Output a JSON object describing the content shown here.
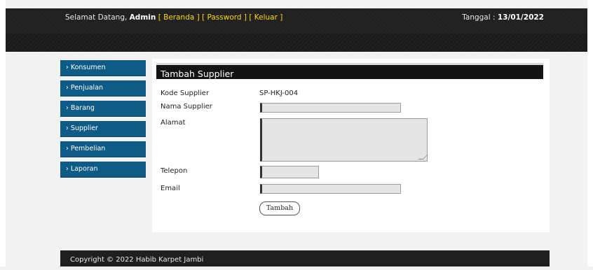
{
  "header": {
    "welcome_prefix": "Selamat Datang,",
    "user": "Admin",
    "links": [
      "Beranda",
      "Password",
      "Keluar"
    ],
    "date_label": "Tanggal :",
    "date_value": "13/01/2022"
  },
  "sidebar": {
    "items": [
      {
        "label": "› Konsumen"
      },
      {
        "label": "› Penjualan"
      },
      {
        "label": "› Barang"
      },
      {
        "label": "› Supplier"
      },
      {
        "label": "› Pembelian"
      },
      {
        "label": "› Laporan"
      }
    ]
  },
  "form": {
    "title": "Tambah Supplier",
    "kode_label": "Kode Supplier",
    "kode_value": "SP-HKJ-004",
    "nama_label": "Nama Supplier",
    "nama_value": "",
    "alamat_label": "Alamat",
    "alamat_value": "",
    "telepon_label": "Telepon",
    "telepon_value": "",
    "email_label": "Email",
    "email_value": "",
    "submit_label": "Tambah"
  },
  "footer": {
    "text": "Copyright © 2022 Habib Karpet Jambi"
  },
  "colors": {
    "menu_bg": "#0e5b86",
    "header_bg": "#202020",
    "link": "#ffd700"
  }
}
